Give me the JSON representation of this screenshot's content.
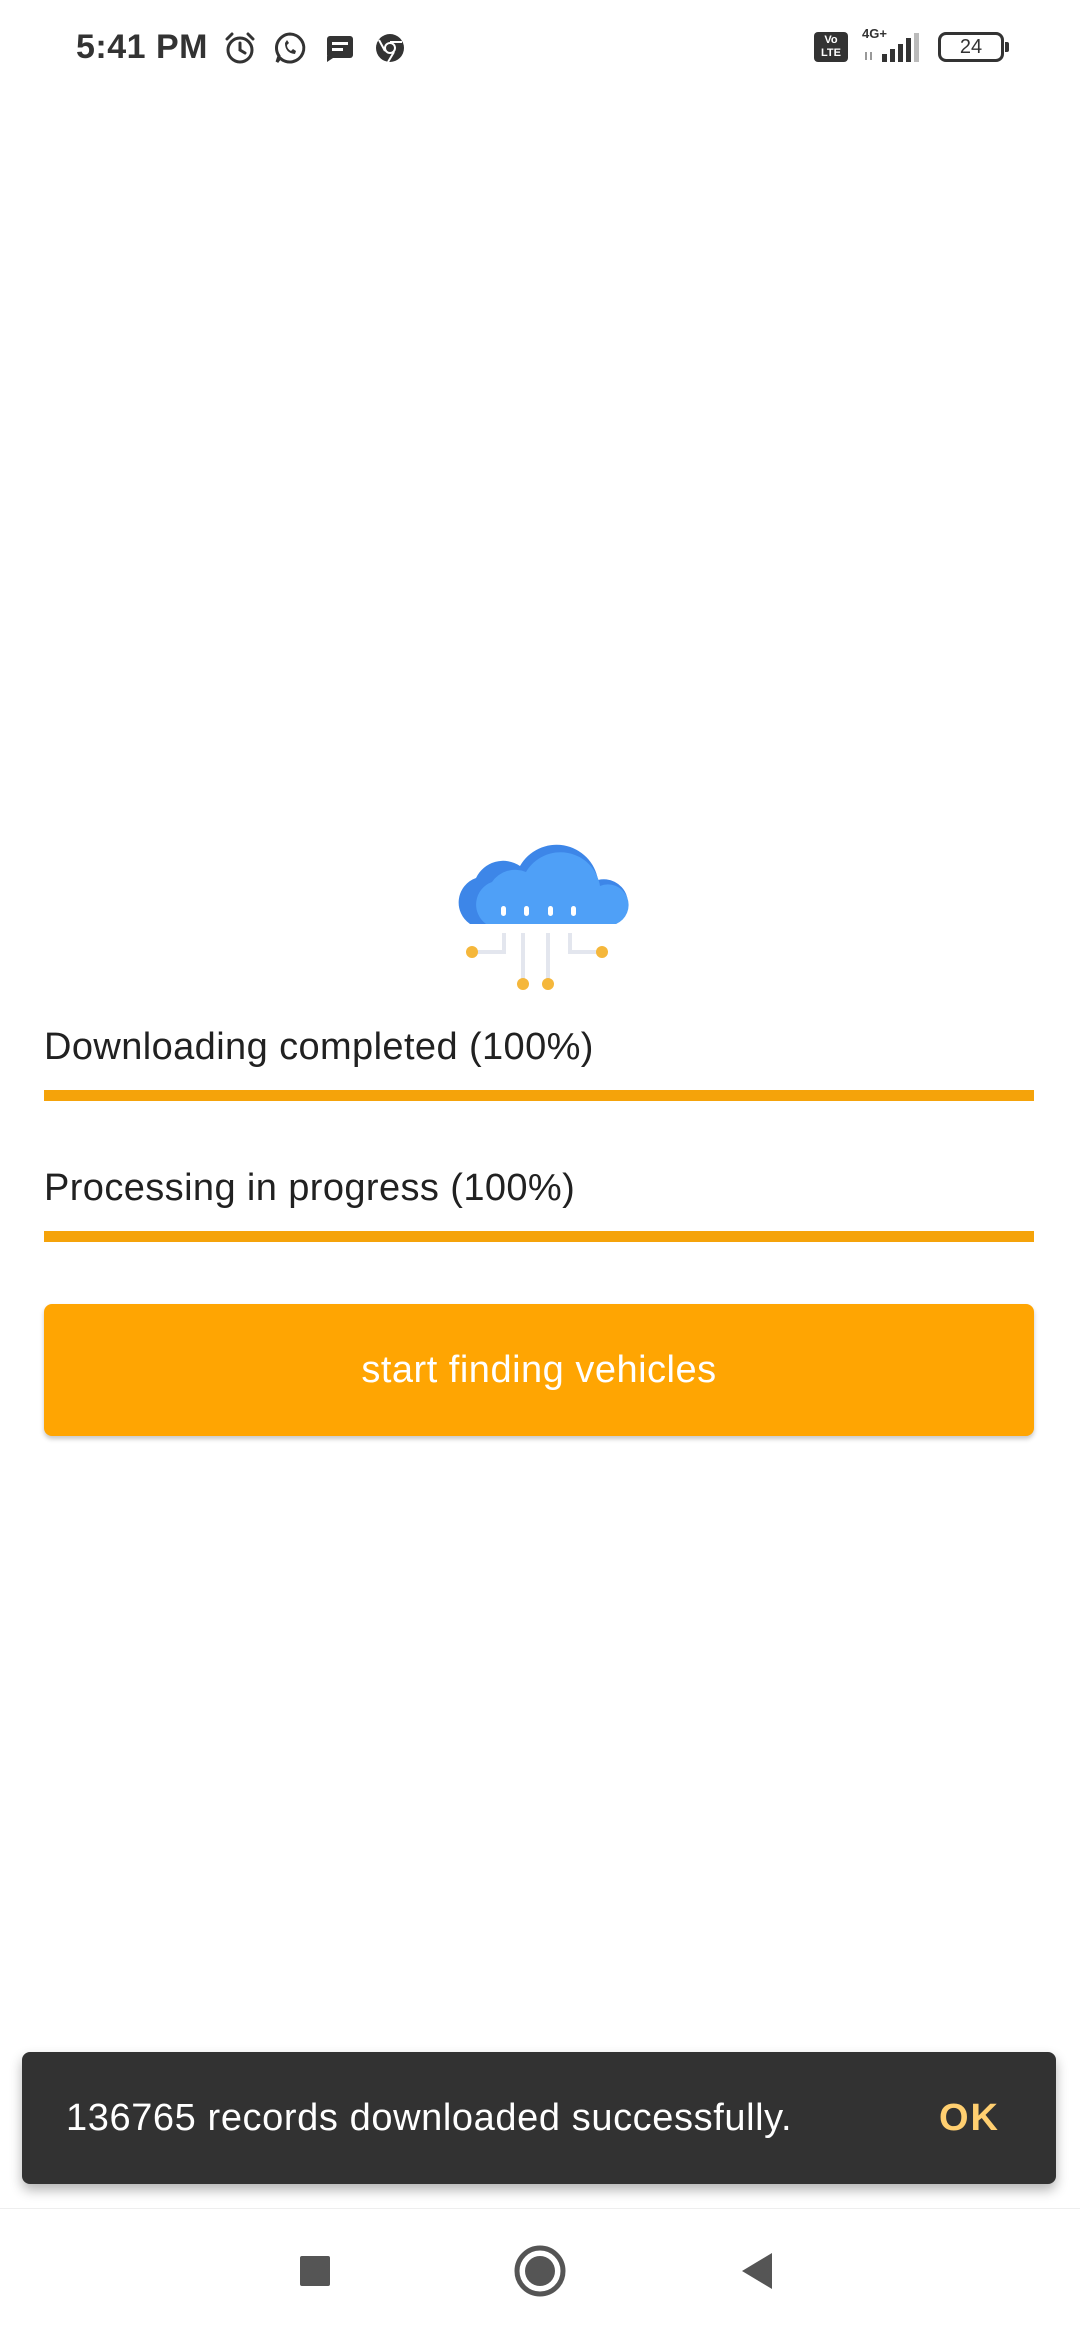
{
  "status_bar": {
    "time": "5:41 PM",
    "left_icons": [
      "alarm-icon",
      "whatsapp-icon",
      "message-icon",
      "chrome-icon"
    ],
    "volte_label": "Vo LTE",
    "network_label": "4G+",
    "battery_level": "24"
  },
  "illustration": {
    "icon": "cloud-download-icon",
    "cloud_color": "#4a9af5",
    "node_color": "#f5b73b"
  },
  "progress": [
    {
      "label": "Downloading completed (100%)",
      "percent": 100
    },
    {
      "label": "Processing in progress (100%)",
      "percent": 100
    }
  ],
  "primary_button": {
    "label": "start finding vehicles",
    "color": "#ffa502"
  },
  "snackbar": {
    "message": "136765 records downloaded successfully.",
    "action": "OK",
    "action_color": "#ffcf70"
  },
  "nav_bar": {
    "buttons": [
      "recents-icon",
      "home-icon",
      "back-icon"
    ]
  },
  "colors": {
    "accent": "#f5a30a",
    "track": "#ffe0a8"
  }
}
